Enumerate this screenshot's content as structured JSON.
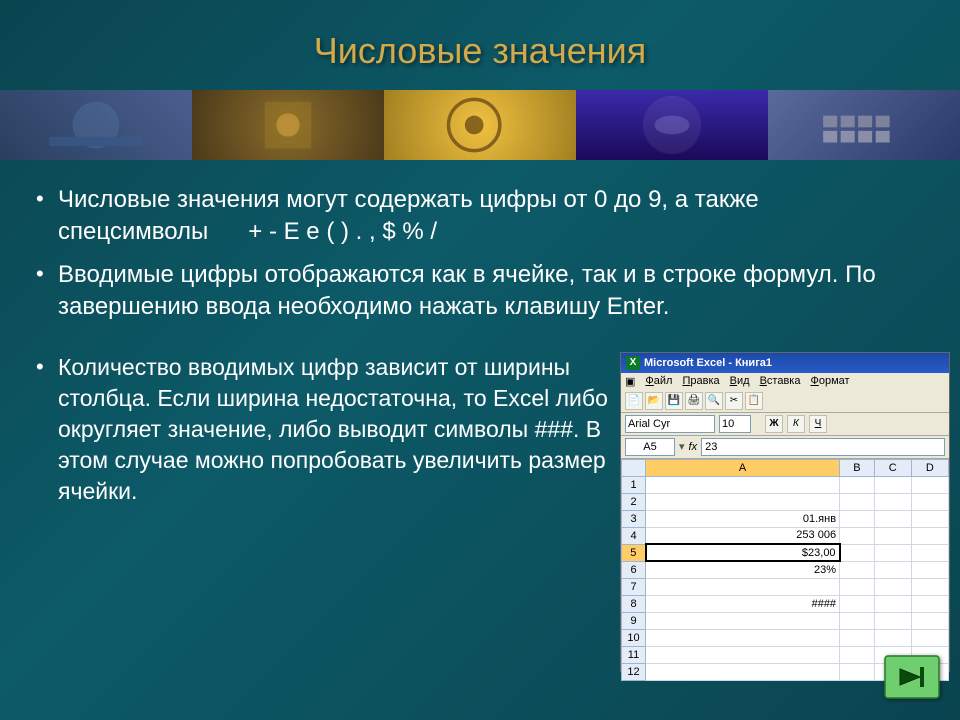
{
  "title": "Числовые значения",
  "bullets_top": [
    "Числовые значения могут содержать цифры от 0 до 9, а также спецсимволы      + - E e ( ) . , $ % /",
    "Вводимые цифры отображаются как в ячейке, так и в строке формул. По завершению ввода необходимо нажать клавишу Enter."
  ],
  "bullet_left": "Количество вводимых цифр зависит от ширины столбца. Если ширина недостаточна, то Excel либо округляет значение, либо выводит символы ###. В этом случае можно попробовать увеличить размер ячейки.",
  "excel": {
    "title": "Microsoft Excel - Книга1",
    "menus": [
      "Файл",
      "Правка",
      "Вид",
      "Вставка",
      "Формат"
    ],
    "font": "Arial Cyr",
    "size": "10",
    "bold": "Ж",
    "ital": "К",
    "und": "Ч",
    "namebox": "A5",
    "fx": "fx",
    "fval": "23",
    "cols": [
      "",
      "A",
      "B",
      "C",
      "D"
    ],
    "rows": [
      {
        "n": "1",
        "a": "",
        "b": "",
        "c": "",
        "d": ""
      },
      {
        "n": "2",
        "a": "",
        "b": "",
        "c": "",
        "d": ""
      },
      {
        "n": "3",
        "a": "01.янв",
        "b": "",
        "c": "",
        "d": ""
      },
      {
        "n": "4",
        "a": "253 006",
        "b": "",
        "c": "",
        "d": ""
      },
      {
        "n": "5",
        "a": "$23,00",
        "b": "",
        "c": "",
        "d": "",
        "sel": true
      },
      {
        "n": "6",
        "a": "23%",
        "b": "",
        "c": "",
        "d": ""
      },
      {
        "n": "7",
        "a": "",
        "b": "",
        "c": "",
        "d": ""
      },
      {
        "n": "8",
        "a": "####",
        "b": "",
        "c": "",
        "d": ""
      },
      {
        "n": "9",
        "a": "",
        "b": "",
        "c": "",
        "d": ""
      },
      {
        "n": "10",
        "a": "",
        "b": "",
        "c": "",
        "d": ""
      },
      {
        "n": "11",
        "a": "",
        "b": "",
        "c": "",
        "d": ""
      },
      {
        "n": "12",
        "a": "",
        "b": "",
        "c": "",
        "d": ""
      }
    ]
  }
}
